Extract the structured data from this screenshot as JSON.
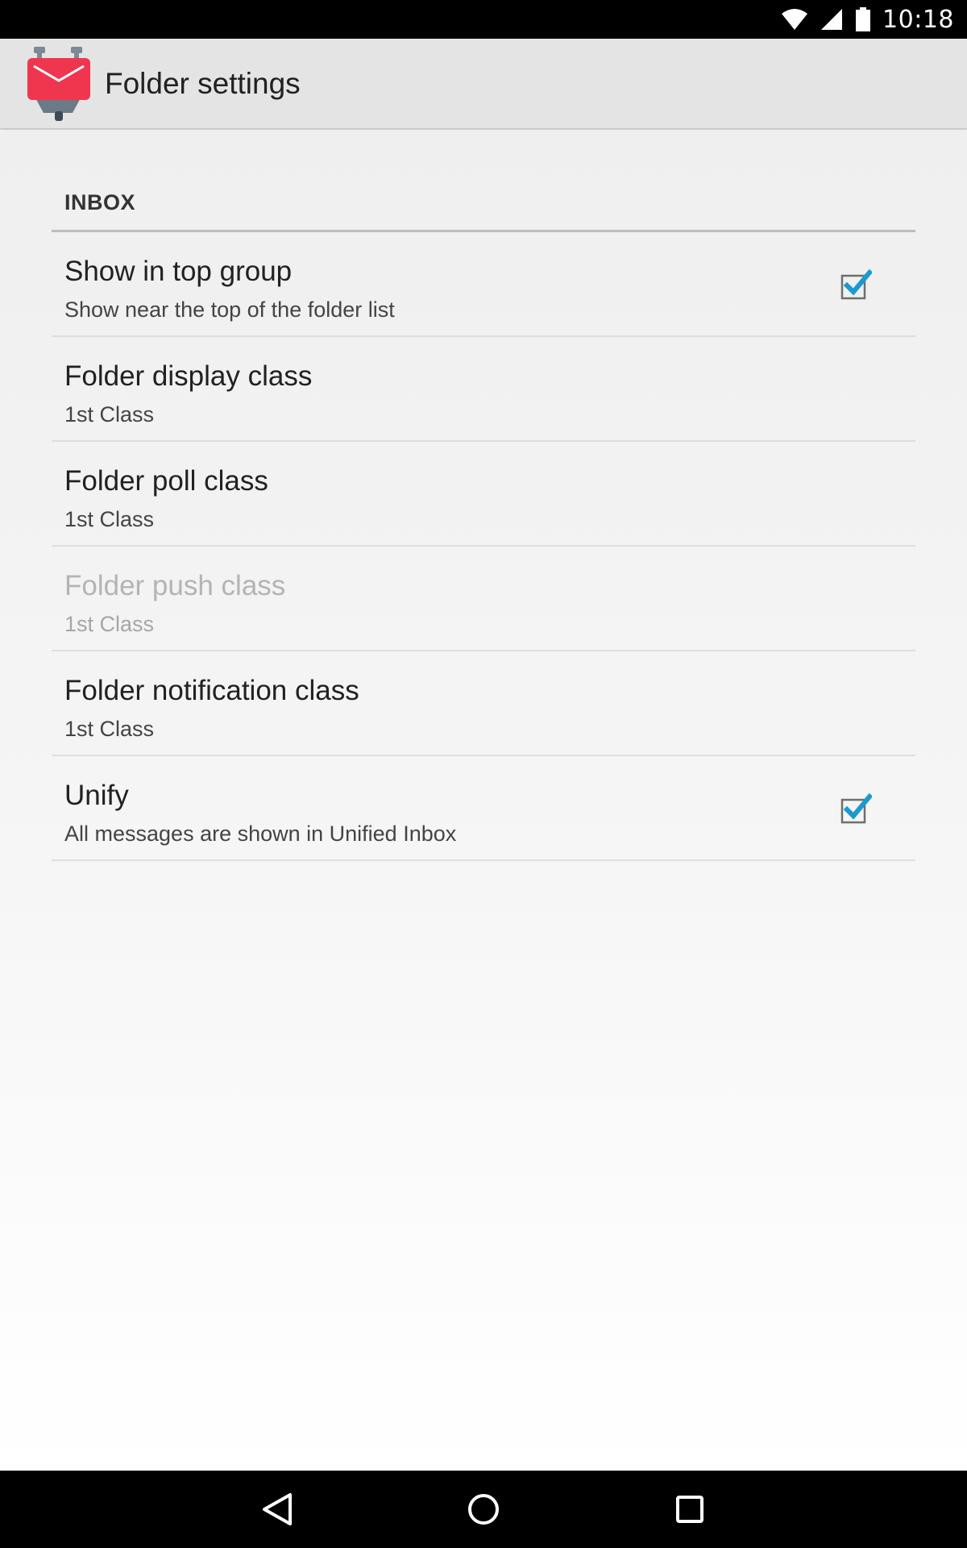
{
  "status_bar": {
    "time": "10:18",
    "icons": [
      "wifi-icon",
      "signal-icon",
      "battery-icon"
    ]
  },
  "action_bar": {
    "title": "Folder settings",
    "app_icon": "k9-mail-icon"
  },
  "section": {
    "title": "INBOX"
  },
  "preferences": [
    {
      "title": "Show in top group",
      "summary": "Show near the top of the folder list",
      "checkbox": true,
      "checked": true,
      "enabled": true
    },
    {
      "title": "Folder display class",
      "summary": "1st Class",
      "checkbox": false,
      "enabled": true
    },
    {
      "title": "Folder poll class",
      "summary": "1st Class",
      "checkbox": false,
      "enabled": true
    },
    {
      "title": "Folder push class",
      "summary": "1st Class",
      "checkbox": false,
      "enabled": false
    },
    {
      "title": "Folder notification class",
      "summary": "1st Class",
      "checkbox": false,
      "enabled": true
    },
    {
      "title": "Unify",
      "summary": "All messages are shown in Unified Inbox",
      "checkbox": true,
      "checked": true,
      "enabled": true
    }
  ],
  "nav_bar": {
    "buttons": [
      "back-icon",
      "home-icon",
      "recents-icon"
    ]
  },
  "colors": {
    "accent": "#1a9ad0",
    "app_icon_red": "#f0364f",
    "checkbox_border": "#6e6e6e"
  }
}
